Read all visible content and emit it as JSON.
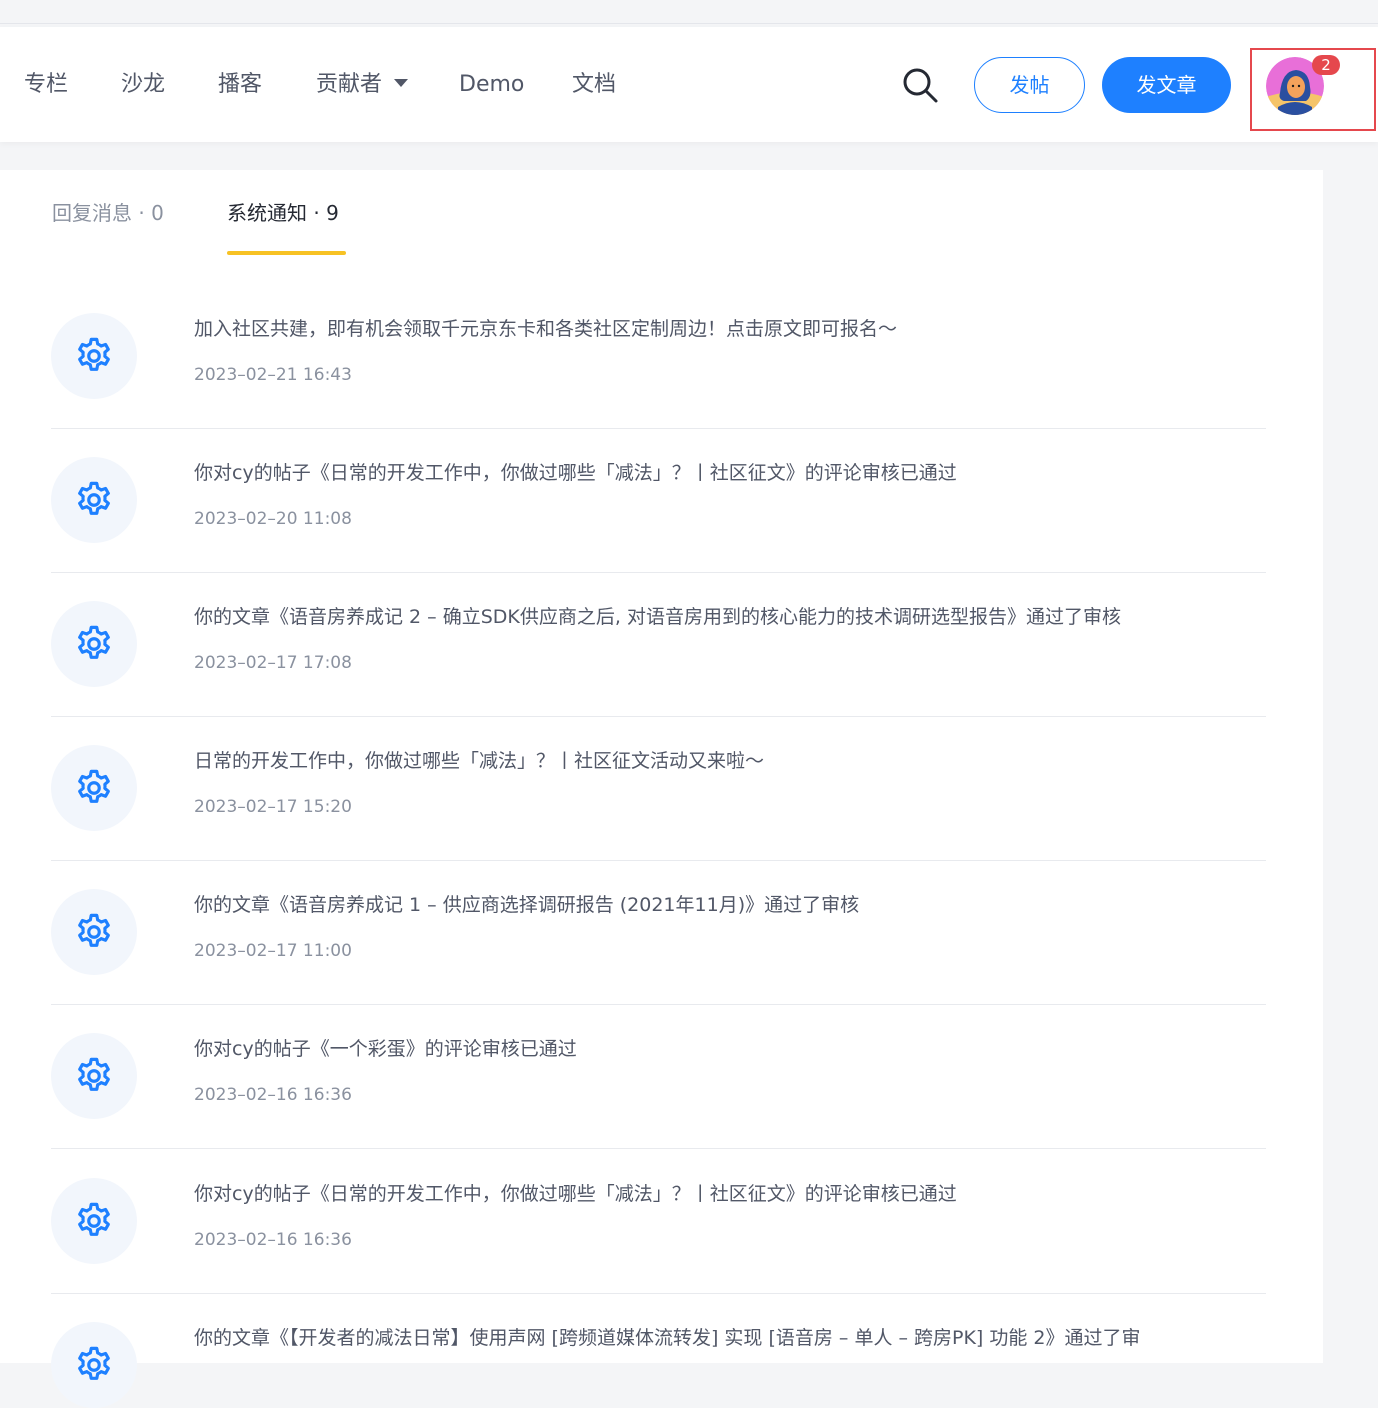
{
  "header": {
    "nav": [
      {
        "label": "专栏"
      },
      {
        "label": "沙龙"
      },
      {
        "label": "播客"
      },
      {
        "label": "贡献者"
      },
      {
        "label": "Demo"
      },
      {
        "label": "文档"
      }
    ],
    "post_button": "发帖",
    "write_button": "发文章",
    "notification_badge": "2"
  },
  "tabs": {
    "reply": "回复消息 · 0",
    "system": "系统通知 · 9"
  },
  "notifications": [
    {
      "title": "加入社区共建，即有机会领取千元京东卡和各类社区定制周边！点击原文即可报名～",
      "time": "2023–02–21 16:43"
    },
    {
      "title": "你对cy的帖子《日常的开发工作中，你做过哪些「减法」？丨社区征文》的评论审核已通过",
      "time": "2023–02–20 11:08"
    },
    {
      "title": "你的文章《语音房养成记 2 – 确立SDK供应商之后, 对语音房用到的核心能力的技术调研选型报告》通过了审核",
      "time": "2023–02–17 17:08"
    },
    {
      "title": "日常的开发工作中，你做过哪些「减法」？丨社区征文活动又来啦～",
      "time": "2023–02–17 15:20"
    },
    {
      "title": "你的文章《语音房养成记 1 – 供应商选择调研报告 (2021年11月)》通过了审核",
      "time": "2023–02–17 11:00"
    },
    {
      "title": "你对cy的帖子《一个彩蛋》的评论审核已通过",
      "time": "2023–02–16 16:36"
    },
    {
      "title": "你对cy的帖子《日常的开发工作中，你做过哪些「减法」？丨社区征文》的评论审核已通过",
      "time": "2023–02–16 16:36"
    },
    {
      "title": "你的文章《【开发者的减法日常】使用声网 [跨频道媒体流转发] 实现 [语音房 – 单人 – 跨房PK] 功能 2》通过了审",
      "time": ""
    }
  ],
  "colors": {
    "accent": "#1e80ff",
    "tab_underline": "#f7c224",
    "badge": "#e5484d"
  }
}
